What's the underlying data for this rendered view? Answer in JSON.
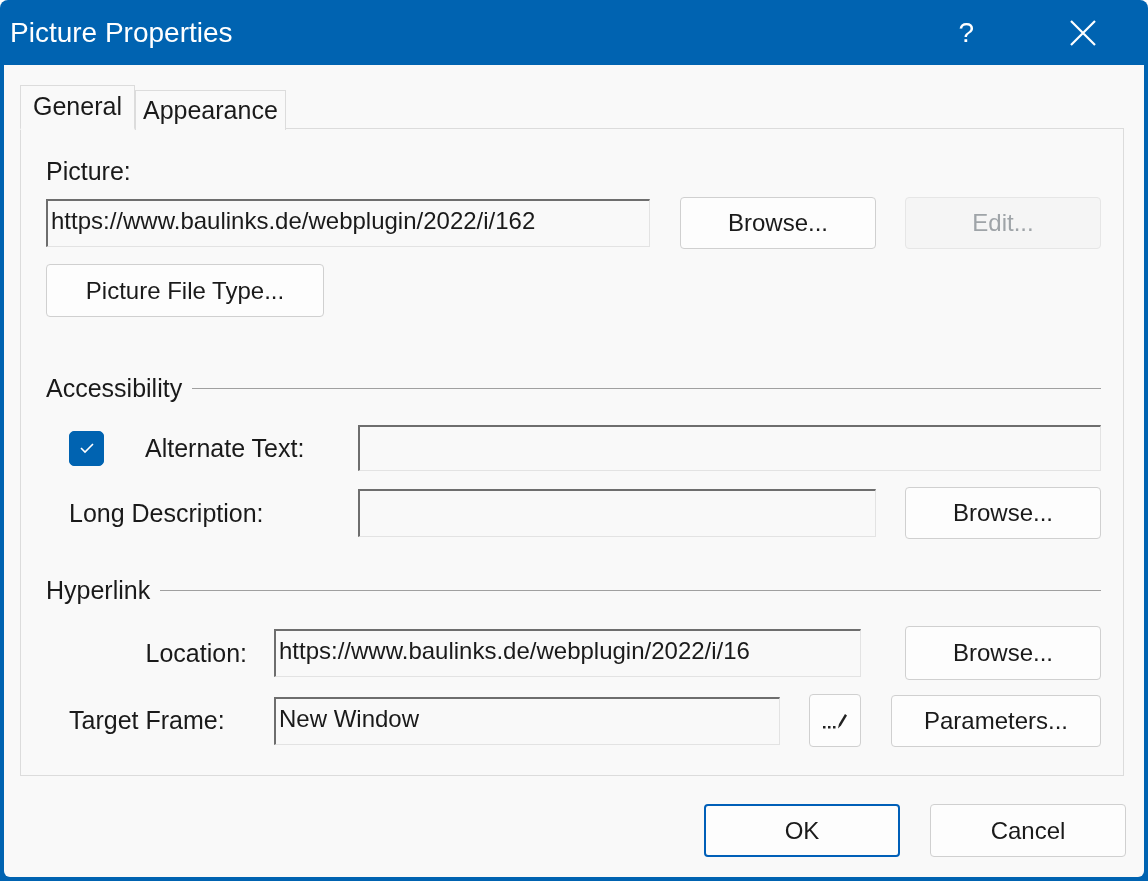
{
  "window": {
    "title": "Picture Properties",
    "help": "?"
  },
  "tabs": [
    {
      "label": "General",
      "selected": true
    },
    {
      "label": "Appearance",
      "selected": false
    }
  ],
  "picture": {
    "label": "Picture:",
    "value": "https://www.baulinks.de/webplugin/2022/i/162",
    "browse": {
      "label": "Browse...",
      "disabled": false
    },
    "edit": {
      "label": "Edit...",
      "disabled": true
    },
    "file_type_button": "Picture File Type..."
  },
  "accessibility": {
    "heading": "Accessibility",
    "alternate_text": {
      "label": "Alternate Text:",
      "checked": true
    },
    "long_description": {
      "label": "Long Description:",
      "browse": "Browse..."
    }
  },
  "hyperlink": {
    "heading": "Hyperlink",
    "location": {
      "label": "Location:",
      "value": "https://www.baulinks.de/webplugin/2022/i/16",
      "browse": "Browse..."
    },
    "target_frame": {
      "label": "Target Frame:",
      "value": "New Window",
      "parameters": "Parameters..."
    }
  },
  "buttons": [
    {
      "label": "OK",
      "default": true
    },
    {
      "label": "Cancel",
      "default": false
    }
  ]
}
